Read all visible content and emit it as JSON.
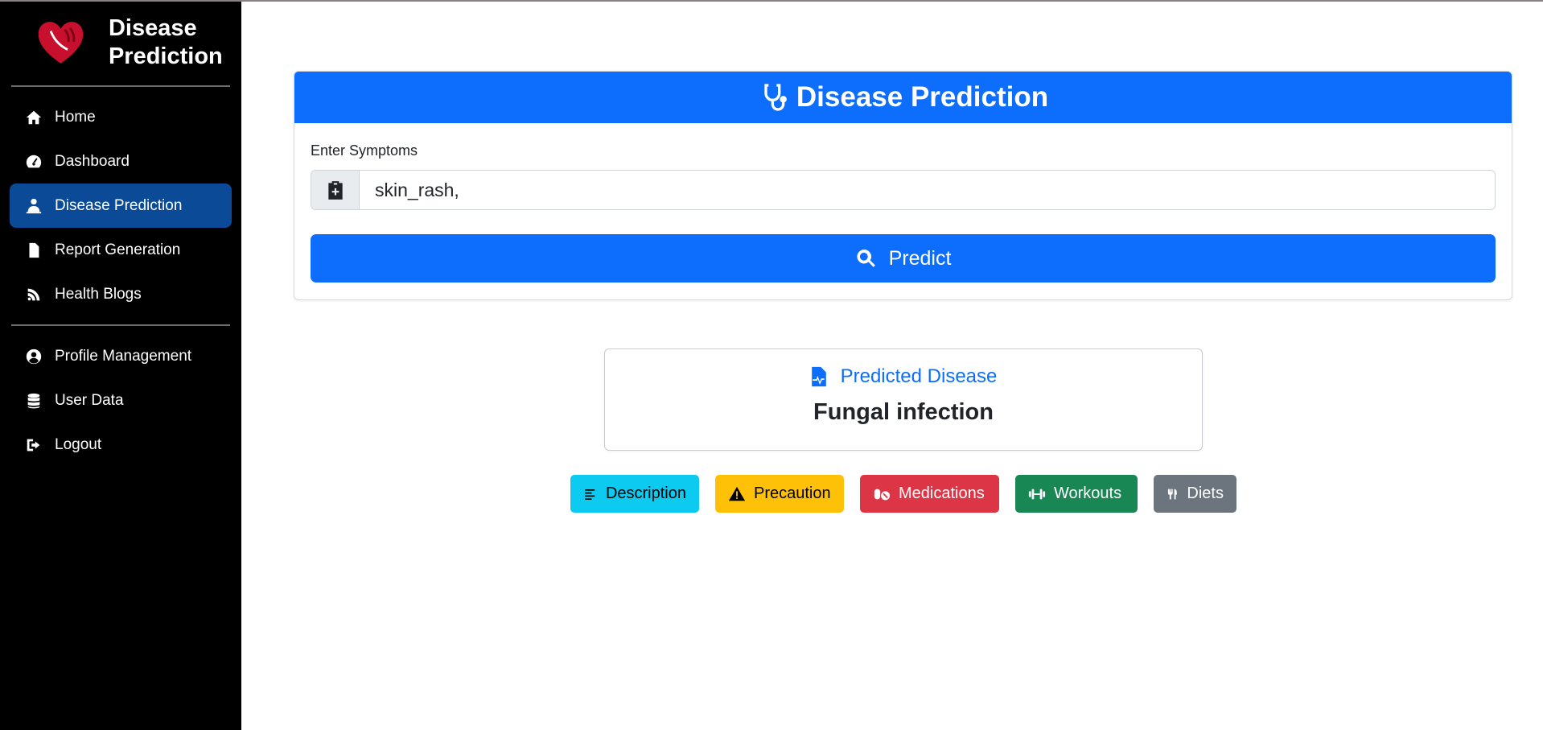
{
  "brand": {
    "title": "Disease Prediction"
  },
  "sidebar": {
    "items": [
      {
        "label": "Home",
        "icon": "home-icon"
      },
      {
        "label": "Dashboard",
        "icon": "gauge-icon"
      },
      {
        "label": "Disease Prediction",
        "icon": "user-injured-icon",
        "active": true
      },
      {
        "label": "Report Generation",
        "icon": "file-icon"
      },
      {
        "label": "Health Blogs",
        "icon": "blog-icon"
      }
    ],
    "items2": [
      {
        "label": "Profile Management",
        "icon": "user-circle-icon"
      },
      {
        "label": "User Data",
        "icon": "database-icon"
      },
      {
        "label": "Logout",
        "icon": "logout-icon"
      }
    ]
  },
  "card": {
    "title": "Disease Prediction",
    "input_label": "Enter Symptoms",
    "input_value": "skin_rash,",
    "predict_label": "Predict"
  },
  "result": {
    "label": "Predicted Disease",
    "value": "Fungal infection"
  },
  "buttons": {
    "description": "Description",
    "precaution": "Precaution",
    "medications": "Medications",
    "workouts": "Workouts",
    "diets": "Diets"
  },
  "colors": {
    "primary": "#0d6efd",
    "sidebar_bg": "#000000",
    "active_nav": "#0a4a97",
    "info": "#0dcaf0",
    "warning": "#ffc107",
    "danger": "#dc3545",
    "success": "#198754",
    "secondary": "#6c757d"
  }
}
